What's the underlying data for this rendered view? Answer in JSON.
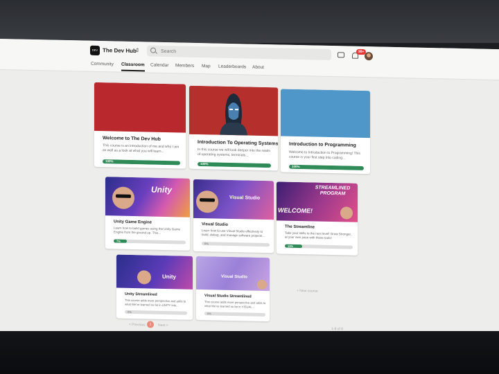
{
  "header": {
    "group_name": "The Dev Hub",
    "logo_text": "DEV HUB",
    "search_placeholder": "Search",
    "notification_badge": "99+"
  },
  "tabs": [
    {
      "label": "Community"
    },
    {
      "label": "Classroom",
      "active": true
    },
    {
      "label": "Calendar"
    },
    {
      "label": "Members"
    },
    {
      "label": "Map"
    },
    {
      "label": "Leaderboards"
    },
    {
      "label": "About"
    }
  ],
  "courses": [
    {
      "title": "Welcome to The Dev Hub",
      "desc": "This course is an introduction of me and who I am as well as a look at what you will learn...",
      "progress": 1.0,
      "progress_label": "100%",
      "thumb_color": "#b8282c"
    },
    {
      "title": "Introduction To Operating Systems",
      "desc": "In this course we will look deeper into the realm of operating systems, terminals...",
      "progress": 1.0,
      "progress_label": "100%",
      "thumb_color": "#b5302d"
    },
    {
      "title": "Introduction to Programming",
      "desc": "Welcome to Introduction to Programming! This course is your first step into coding...",
      "progress": 1.0,
      "progress_label": "100%",
      "thumb_color": "#4f97c9"
    },
    {
      "title": "Unity Game Engine",
      "desc": "Learn how to build games using the Unity Game Engine from the ground up. This...",
      "progress": 0.07,
      "progress_label": "7%",
      "thumb_text": "Unity"
    },
    {
      "title": "Visual Studio",
      "desc": "Learn how to use Visual Studio effectively to build, debug, and manage software projects...",
      "progress": 0.0,
      "progress_label": "0%",
      "thumb_text": "Visual Studio"
    },
    {
      "title": "The Streamline",
      "desc": "Take your skills to the next level! Grow Stronger, at your own pace with these tools!",
      "progress": 0.13,
      "progress_label": "13%",
      "thumb_text_1": "STREAMLINED PROGRAM",
      "thumb_text_2": "WELCOME!"
    },
    {
      "title": "Unity Streamlined",
      "desc": "This course adds more perspective and adds to what We've learned so far in UNITY into...",
      "progress": 0.0,
      "progress_label": "0%",
      "thumb_text": "Unity"
    },
    {
      "title": "Visual Studio Streamlined",
      "desc": "This course adds more perspective and adds to what We've learned so far in VISUAL...",
      "progress": 0.0,
      "progress_label": "0%",
      "thumb_text": "Visual Studio"
    }
  ],
  "new_course_label": "+ New course",
  "pagination": {
    "prev": "< Previous",
    "current": "1",
    "next": "Next >",
    "count": "1-8 of 8"
  },
  "colors": {
    "progress": "#2e8b57",
    "badge": "#e33333"
  }
}
